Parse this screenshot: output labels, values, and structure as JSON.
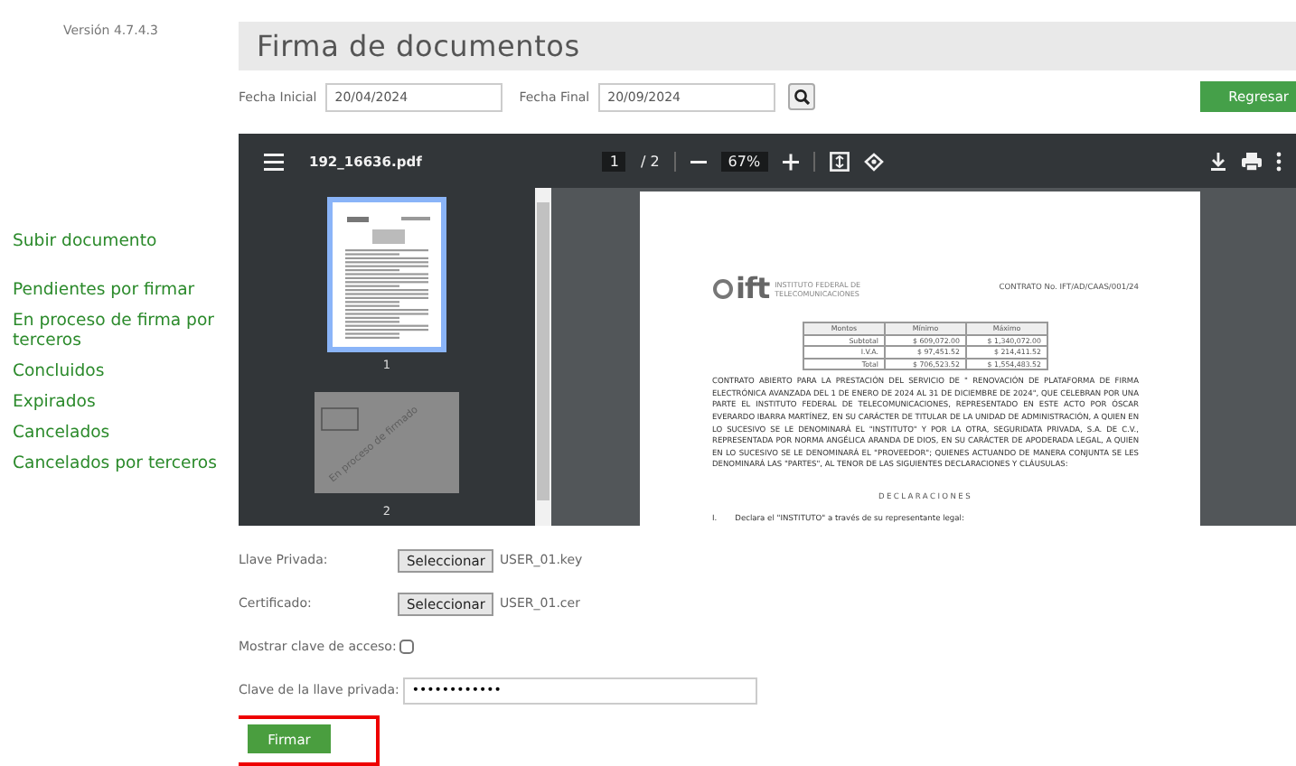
{
  "version": "Versión 4.7.4.3",
  "sidebar": {
    "items": [
      {
        "label": "Subir documento",
        "kind": "action"
      },
      {
        "label": "Pendientes por firmar",
        "kind": "list"
      },
      {
        "label": "En proceso de firma por terceros",
        "kind": "list"
      },
      {
        "label": "Concluidos",
        "kind": "list"
      },
      {
        "label": "Expirados",
        "kind": "list"
      },
      {
        "label": "Cancelados",
        "kind": "list"
      },
      {
        "label": "Cancelados por terceros",
        "kind": "list"
      }
    ]
  },
  "title": "Firma de documentos",
  "filters": {
    "start_label": "Fecha Inicial",
    "start_value": "20/04/2024",
    "end_label": "Fecha Final",
    "end_value": "20/09/2024"
  },
  "back_button": "Regresar",
  "pdf_viewer": {
    "file_name": "192_16636.pdf",
    "page": "1",
    "page_total": "/ 2",
    "zoom": "67%",
    "thumbnails": [
      {
        "label": "1",
        "kind": "page",
        "selected": true
      },
      {
        "label": "2",
        "kind": "stamp",
        "selected": false,
        "stamp": "En proceso de firmado"
      }
    ],
    "document": {
      "logo": "ift",
      "institution": "INSTITUTO FEDERAL DE TELECOMUNICACIONES",
      "contract_no": "CONTRATO No. IFT/AD/CAAS/001/24",
      "table": {
        "columns": [
          "Montos",
          "Mínimo",
          "Máximo"
        ],
        "rows": [
          [
            "Subtotal",
            "$ 609,072.00",
            "$ 1,340,072.00"
          ],
          [
            "I.V.A.",
            "$ 97,451.52",
            "$ 214,411.52"
          ],
          [
            "Total",
            "$ 706,523.52",
            "$ 1,554,483.52"
          ]
        ]
      },
      "intro": "CONTRATO ABIERTO PARA LA PRESTACIÓN DEL SERVICIO DE \" RENOVACIÓN DE PLATAFORMA DE FIRMA ELECTRÓNICA AVANZADA DEL 1 DE ENERO DE 2024 AL 31 DE DICIEMBRE DE 2024\", QUE CELEBRAN POR UNA PARTE EL INSTITUTO FEDERAL DE TELECOMUNICACIONES, REPRESENTADO EN ESTE ACTO POR ÓSCAR EVERARDO IBARRA MARTÍNEZ, EN SU CARÁCTER DE TITULAR DE LA UNIDAD DE ADMINISTRACIÓN, A QUIEN EN LO SUCESIVO SE LE DENOMINARÁ EL \"INSTITUTO\" Y POR LA OTRA, SEGURIDATA PRIVADA, S.A. DE C.V., REPRESENTADA POR NORMA ANGÉLICA ARANDA DE DIOS, EN SU CARÁCTER DE APODERADA LEGAL, A QUIEN EN LO SUCESIVO SE LE DENOMINARÁ EL \"PROVEEDOR\"; QUIENES ACTUANDO DE MANERA CONJUNTA SE LES DENOMINARÁ LAS \"PARTES\", AL TENOR DE LAS SIGUIENTES DECLARACIONES Y CLÁUSULAS:",
      "heading": "DECLARACIONES",
      "clause_number": "I.",
      "clause": "Declara el \"INSTITUTO\" a través de su representante legal:"
    }
  },
  "form": {
    "fields": [
      {
        "kind": "file",
        "label": "Llave Privada:",
        "button": "Seleccionar",
        "file": "USER_01.key"
      },
      {
        "kind": "file",
        "label": "Certificado:",
        "button": "Seleccionar",
        "file": "USER_01.cer"
      },
      {
        "kind": "checkbox",
        "label": "Mostrar clave de acceso:",
        "checked": false
      },
      {
        "kind": "password",
        "label": "Clave de la llave privada:",
        "value": "••••••••••••"
      }
    ]
  },
  "sign_button": {
    "label": "Firmar",
    "highlighted": true
  }
}
